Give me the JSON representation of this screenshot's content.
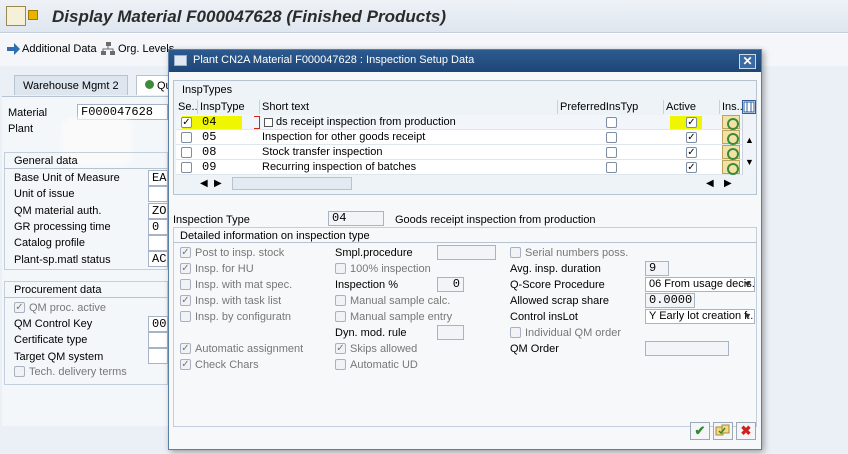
{
  "window": {
    "title": "Display Material F000047628 (Finished Products)"
  },
  "toolbar": {
    "additional_data": "Additional Data",
    "org_levels": "Org. Levels"
  },
  "tabs": {
    "warehouse": "Warehouse Mgmt 2",
    "quality": "Qu"
  },
  "material": {
    "label": "Material",
    "value": "F000047628",
    "plant_label": "Plant"
  },
  "general_data": {
    "header": "General data",
    "rows": [
      {
        "label": "Base Unit of Measure",
        "value": "EA"
      },
      {
        "label": "Unit of issue",
        "value": ""
      },
      {
        "label": "QM material auth.",
        "value": "ZO"
      },
      {
        "label": "GR processing time",
        "value": "0"
      },
      {
        "label": "Catalog profile",
        "value": ""
      },
      {
        "label": "Plant-sp.matl status",
        "value": "AC"
      }
    ]
  },
  "procurement_data": {
    "header": "Procurement data",
    "qm_proc_active": "QM proc. active",
    "rows": [
      {
        "label": "QM Control Key",
        "value": "000"
      },
      {
        "label": "Certificate type",
        "value": ""
      },
      {
        "label": "Target QM system",
        "value": ""
      }
    ],
    "tech_delivery": "Tech. delivery terms"
  },
  "dialog": {
    "title": "Plant CN2A Material F000047628 : Inspection Setup Data",
    "table_caption": "InspTypes",
    "columns": [
      "Se...",
      "InspType",
      "Short text",
      "PreferredInsTyp",
      "Active",
      "Ins..."
    ],
    "rows": [
      {
        "type": "04",
        "text": "ds receipt inspection from production",
        "selected": true,
        "preferred": false,
        "active": true
      },
      {
        "type": "05",
        "text": "Inspection for other goods receipt",
        "selected": false,
        "preferred": false,
        "active": true
      },
      {
        "type": "08",
        "text": "Stock transfer inspection",
        "selected": false,
        "preferred": false,
        "active": true
      },
      {
        "type": "09",
        "text": "Recurring inspection of batches",
        "selected": false,
        "preferred": false,
        "active": true
      }
    ],
    "inspection_type_label": "Inspection Type",
    "inspection_type_value": "04",
    "inspection_type_desc": "Goods receipt inspection from production",
    "detail_header": "Detailed information on inspection type",
    "col1": [
      {
        "label": "Post to insp. stock",
        "checked": true
      },
      {
        "label": "Insp. for HU",
        "checked": true
      },
      {
        "label": "Insp. with mat spec.",
        "checked": false
      },
      {
        "label": "Insp. with task list",
        "checked": true
      },
      {
        "label": "Insp. by configuratn",
        "checked": false
      }
    ],
    "col1b": [
      {
        "label": "Automatic assignment",
        "checked": true
      },
      {
        "label": "Check Chars",
        "checked": true
      }
    ],
    "smpl_procedure_label": "Smpl.procedure",
    "pct100_label": "100% inspection",
    "inspection_pct_label": "Inspection %",
    "inspection_pct_value": "0",
    "manual_sample_calc": "Manual sample calc.",
    "manual_sample_entry": "Manual sample entry",
    "dyn_mod_rule_label": "Dyn. mod. rule",
    "skips_allowed": "Skips allowed",
    "online_ud": "Automatic UD",
    "serial_numbers": "Serial numbers poss.",
    "avg_duration_label": "Avg. insp. duration",
    "avg_duration_value": "9",
    "qscore_label": "Q-Score Procedure",
    "qscore_value": "06 From usage decis...",
    "allowed_scrap_label": "Allowed scrap share",
    "allowed_scrap_value": "0.0000",
    "control_inslot_label": "Control insLot",
    "control_inslot_value": "Y Early lot creation f...",
    "individual_qm_order": "Individual QM order",
    "qm_order_label": "QM Order"
  },
  "colors": {
    "dialog_title_bg": "#1e4677",
    "highlight": "#f0f500",
    "background": "#eaf0f6"
  }
}
